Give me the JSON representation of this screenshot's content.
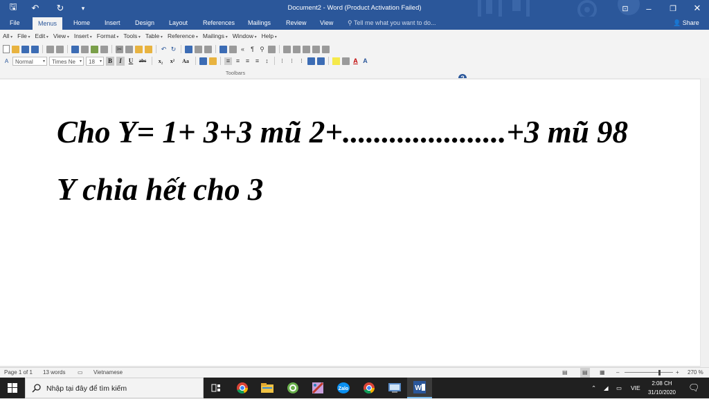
{
  "window": {
    "title": "Document2 - Word (Product Activation Failed)",
    "minimize": "–",
    "restore": "❐",
    "close": "✕",
    "ribbon_display": "⊡"
  },
  "quick_access": {
    "save": "🖫",
    "undo": "↶",
    "redo": "↻",
    "customize": "▾"
  },
  "tabs": [
    "File",
    "Menus",
    "Home",
    "Insert",
    "Design",
    "Layout",
    "References",
    "Mailings",
    "Review",
    "View"
  ],
  "active_tab": "Menus",
  "tell_me": "Tell me what you want to do...",
  "share": "Share",
  "menus": [
    "All",
    "File",
    "Edit",
    "View",
    "Insert",
    "Format",
    "Tools",
    "Table",
    "Reference",
    "Mailings",
    "Window",
    "Help"
  ],
  "formatting": {
    "style": "Normal",
    "font": "Times Ne",
    "size": "18",
    "bold": "B",
    "italic": "I",
    "underline": "U",
    "strike": "abc",
    "subscript": "x₂",
    "superscript": "x²",
    "case": "Aa"
  },
  "toolbars_label": "Toolbars",
  "document": {
    "line1": "Cho Y= 1+ 3+3 mũ 2+.....................+3 mũ 98",
    "line2": "Y chia hết cho 3"
  },
  "status": {
    "page": "Page 1 of 1",
    "words": "13 words",
    "language": "Vietnamese",
    "zoom": "270 %"
  },
  "taskbar": {
    "search_placeholder": "Nhập tại đây để tìm kiếm",
    "language": "VIE",
    "time": "2:08 CH",
    "date": "31/10/2020"
  },
  "colors": {
    "word_blue": "#2b579a",
    "ribbon_bg": "#f3f3f3",
    "taskbar": "#202020"
  }
}
